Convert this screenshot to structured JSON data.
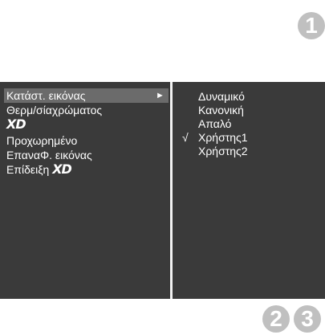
{
  "steps": [
    "1",
    "2",
    "3"
  ],
  "menu": {
    "items": [
      {
        "label": "Κατάστ. εικόνας",
        "arrow": "►"
      },
      {
        "label": "Θερμ/σίαχρώματος"
      },
      {
        "logo": "XD"
      },
      {
        "label": "Προχωρημένο"
      },
      {
        "label": "ΕπαναΦ. εικόνας"
      },
      {
        "label": "Επίδειξη",
        "logo": "XD"
      }
    ]
  },
  "submenu": {
    "check_mark": "√",
    "items": [
      {
        "label": "Δυναμικό"
      },
      {
        "label": "Κανονική"
      },
      {
        "label": "Απαλό"
      },
      {
        "label": "Χρήστης1"
      },
      {
        "label": "Χρήστης2"
      }
    ]
  },
  "colors": {
    "osd_background": "#3a3a3a",
    "selection_highlight": "#6b6b6b",
    "badge": "#c0c0c0"
  }
}
